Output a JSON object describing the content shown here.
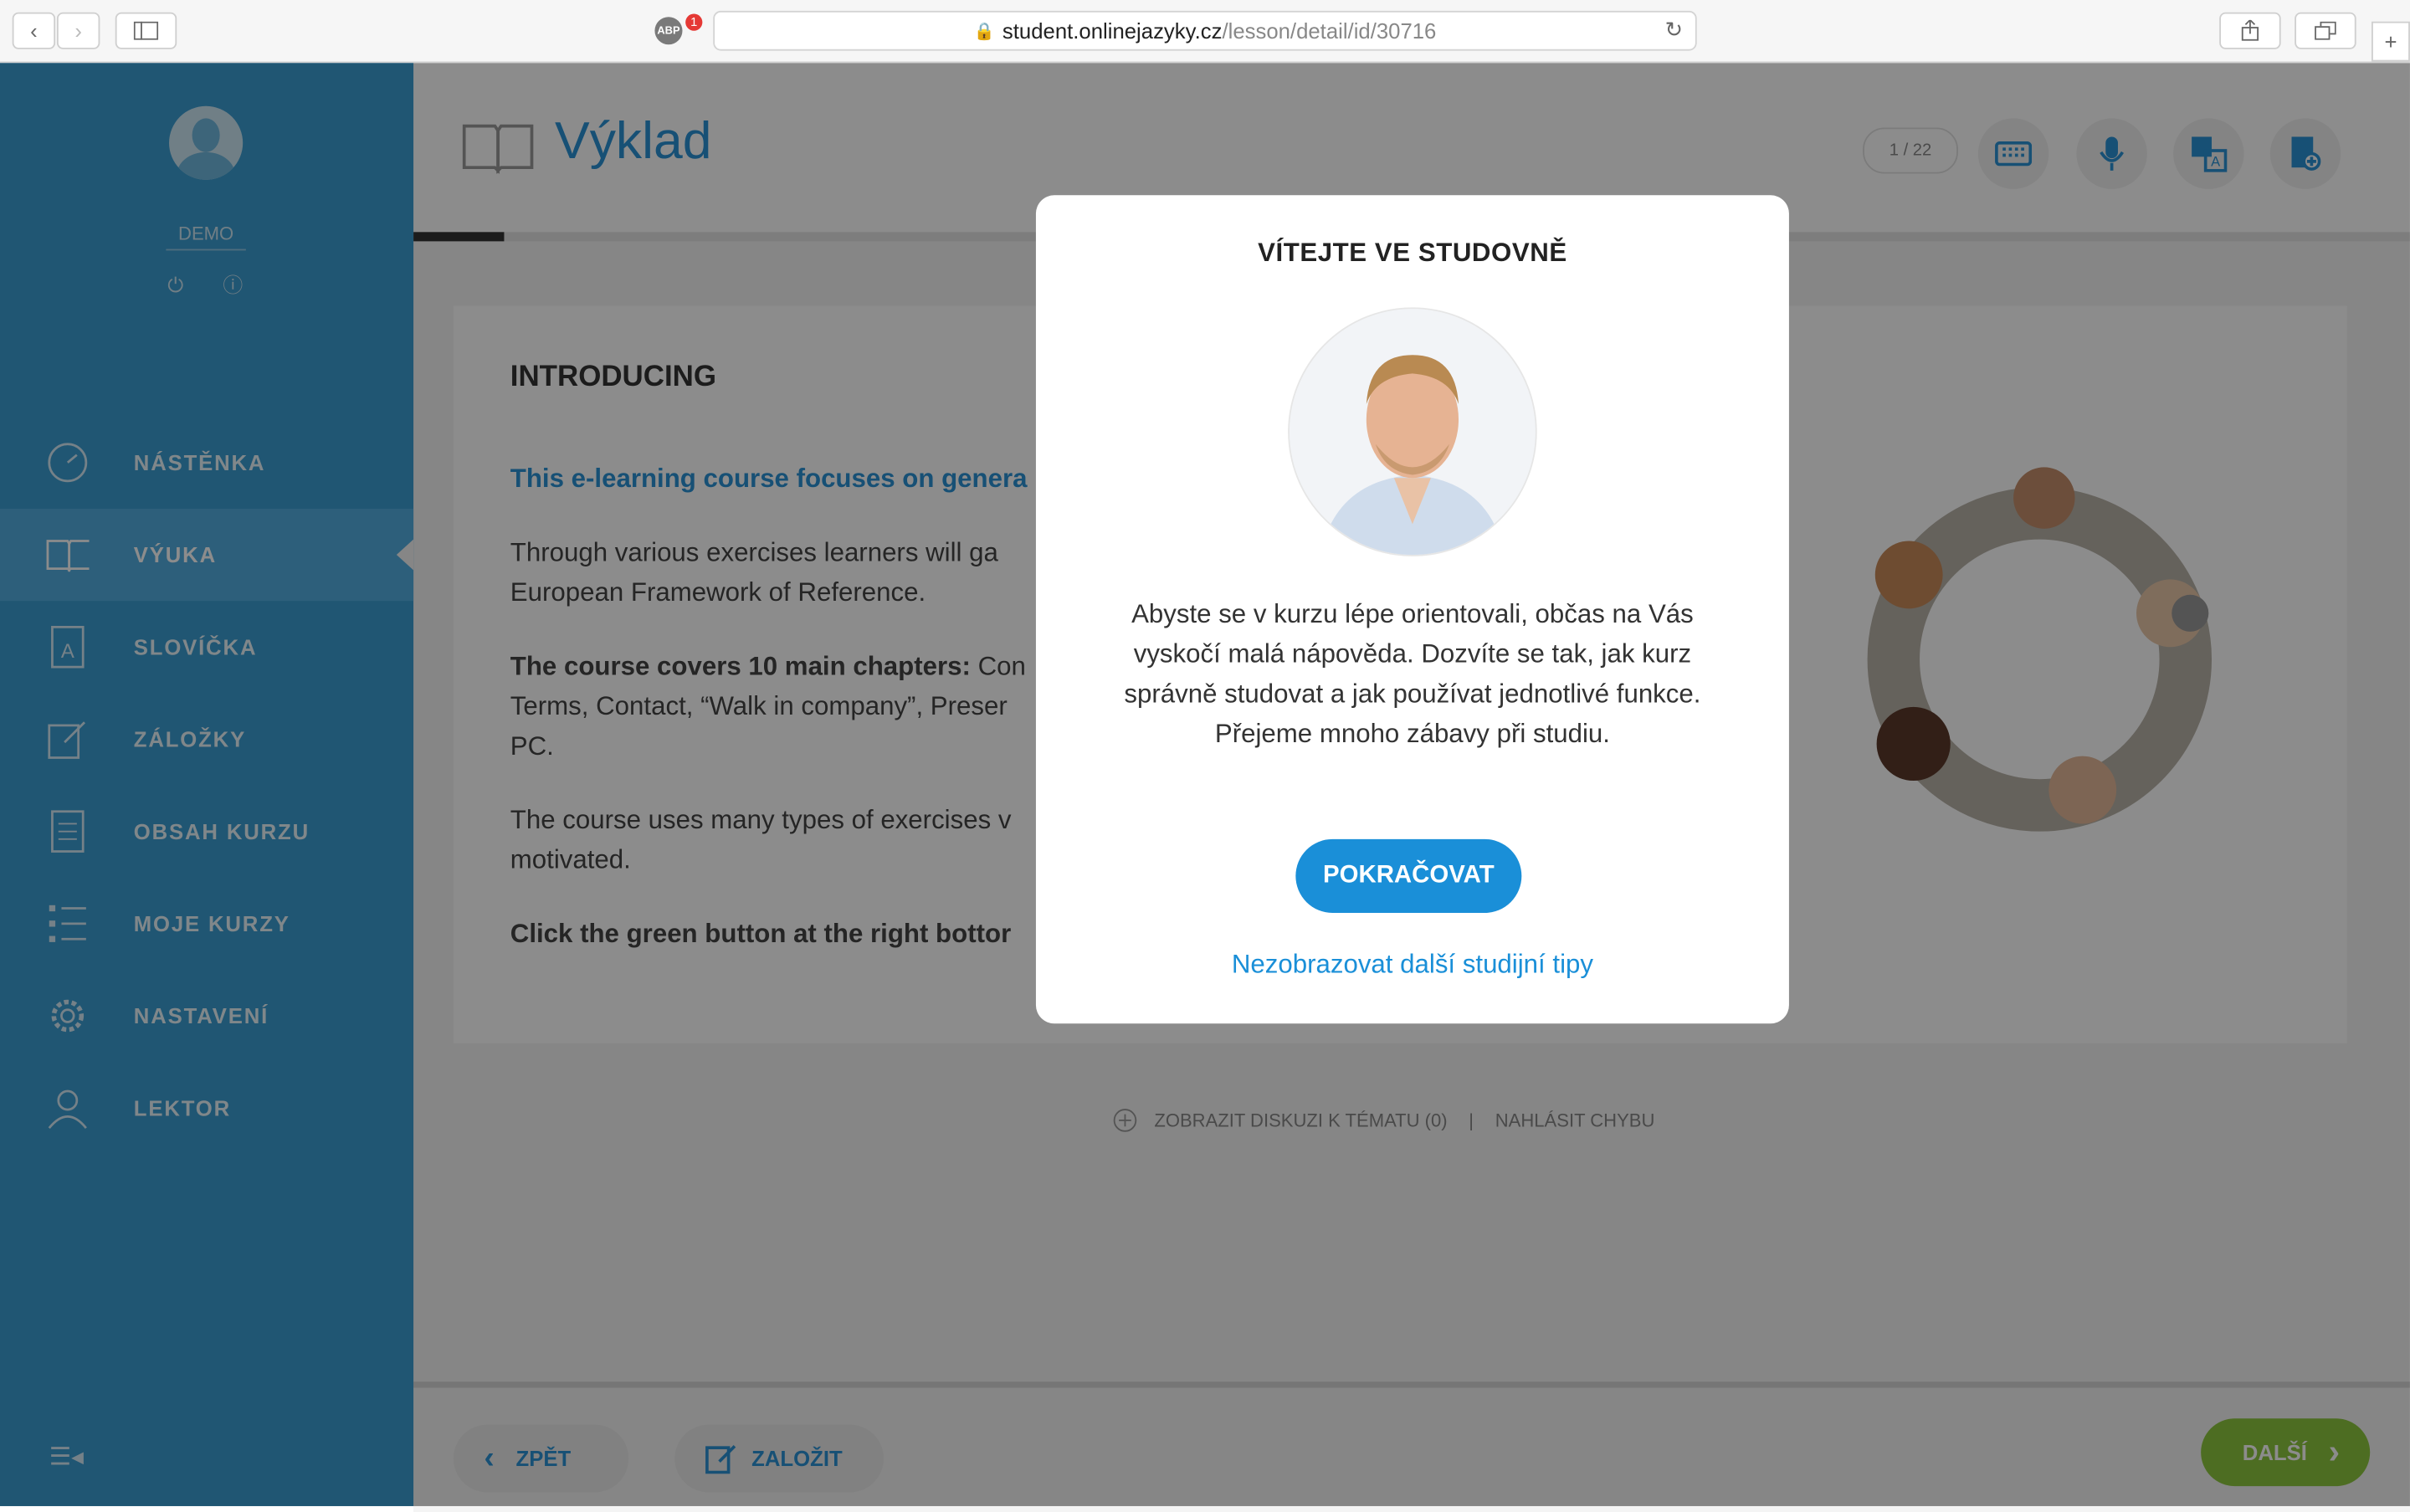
{
  "browser": {
    "url_host": "student.onlinejazyky.cz",
    "url_path": "/lesson/detail/id/30716",
    "adblock_label": "ABP",
    "adblock_count": "1"
  },
  "sidebar": {
    "username": "DEMO",
    "items": [
      {
        "label": "NÁSTĚNKA",
        "icon": "dashboard-icon"
      },
      {
        "label": "VÝUKA",
        "icon": "book-icon"
      },
      {
        "label": "SLOVÍČKA",
        "icon": "vocabulary-icon"
      },
      {
        "label": "ZÁLOŽKY",
        "icon": "bookmark-edit-icon"
      },
      {
        "label": "OBSAH KURZU",
        "icon": "document-icon"
      },
      {
        "label": "MOJE KURZY",
        "icon": "list-icon"
      },
      {
        "label": "NASTAVENÍ",
        "icon": "gear-icon"
      },
      {
        "label": "LEKTOR",
        "icon": "user-icon"
      }
    ]
  },
  "header": {
    "title": "Výklad",
    "counter": "1 / 22"
  },
  "content": {
    "heading": "INTRODUCING",
    "lead": "This e-learning course focuses on genera",
    "p1": "Through various exercises learners will ga",
    "p1b": "European Framework of Reference.",
    "p2_bold": "The course covers 10 main chapters:",
    "p2_rest": " Con",
    "p2b": "Terms, Contact, “Walk in company”, Preser",
    "p2c": "PC.",
    "p3": "The course uses many types of exercises v",
    "p3b": "motivated.",
    "p4": "Click the green button at the right bottor"
  },
  "links": {
    "discussion": "ZOBRAZIT DISKUZI K TÉMATU (0)",
    "separator": "|",
    "report": "NAHLÁSIT CHYBU"
  },
  "footer": {
    "back": "ZPĚT",
    "bookmark": "ZALOŽIT",
    "next": "DALŠÍ"
  },
  "modal": {
    "title": "VÍTEJTE VE STUDOVNĚ",
    "text_line1": "Abyste se v kurzu lépe orientovali, občas na Vás",
    "text_line2": "vyskočí malá nápověda. Dozvíte se tak, jak kurz",
    "text_line3": "správně studovat a jak používat jednotlivé funkce.",
    "text_line4": "Přejeme mnoho zábavy při studiu.",
    "continue": "POKRAČOVAT",
    "dismiss": "Nezobrazovat další studijní tipy"
  },
  "colors": {
    "sidebar": "#3b9dd1",
    "accent_blue": "#1a8fd8",
    "next_green": "#8cc63f"
  }
}
